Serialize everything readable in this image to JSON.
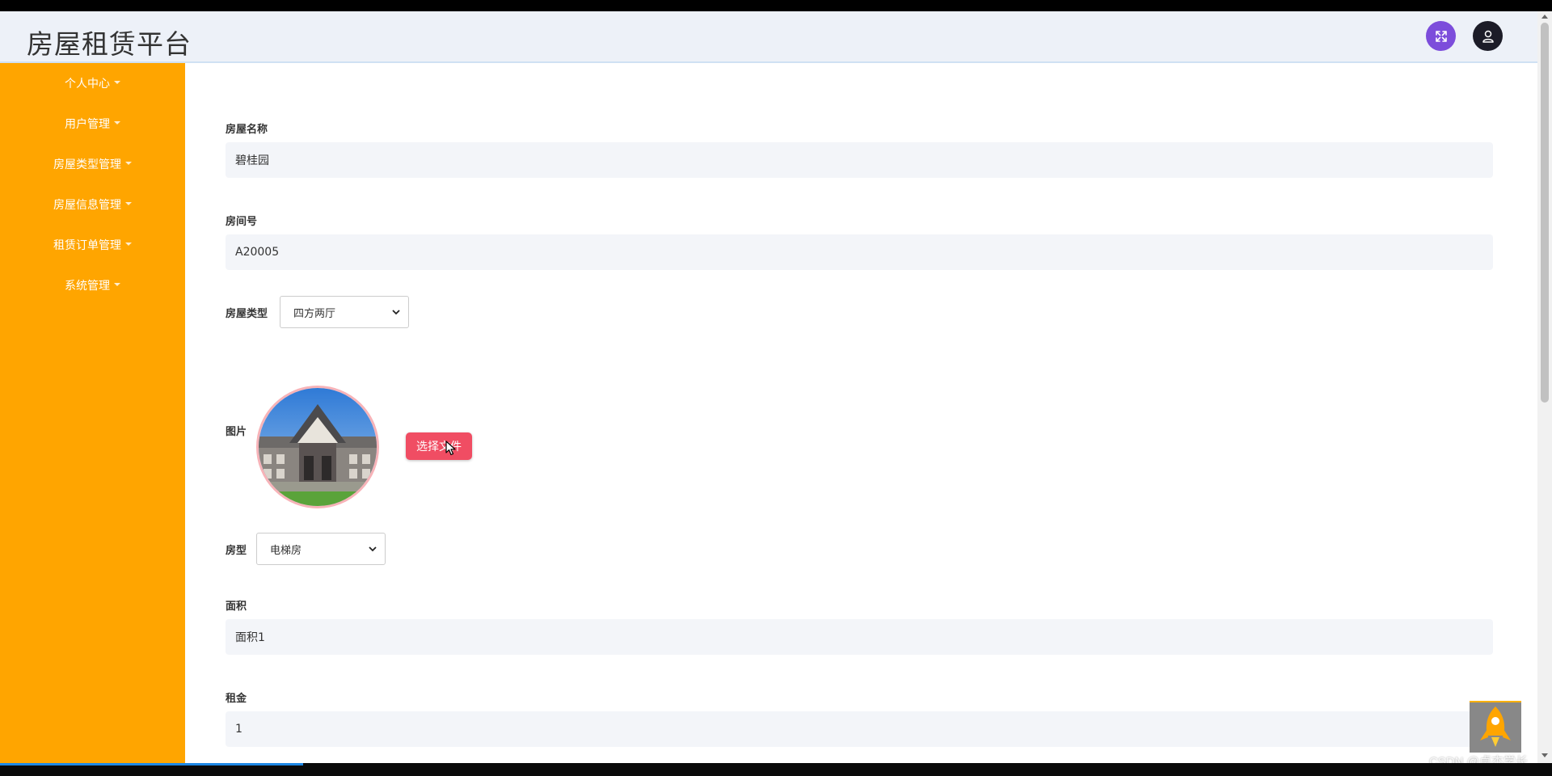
{
  "header": {
    "app_title": "房屋租赁平台"
  },
  "sidebar": {
    "items": [
      {
        "label": "个人中心"
      },
      {
        "label": "用户管理"
      },
      {
        "label": "房屋类型管理"
      },
      {
        "label": "房屋信息管理"
      },
      {
        "label": "租赁订单管理"
      },
      {
        "label": "系统管理"
      }
    ]
  },
  "form": {
    "house_name": {
      "label": "房屋名称",
      "value": "碧桂园"
    },
    "room_no": {
      "label": "房间号",
      "value": "A20005"
    },
    "house_type": {
      "label": "房屋类型",
      "selected": "四方两厅"
    },
    "picture": {
      "label": "图片",
      "button": "选择文件"
    },
    "layout": {
      "label": "房型",
      "selected": "电梯房"
    },
    "area": {
      "label": "面积",
      "value": "面积1"
    },
    "rent": {
      "label": "租金",
      "value": "1"
    }
  },
  "watermark": "CSDN @卓杰学长",
  "colors": {
    "sidebar": "#ffa500",
    "header": "#edf1f8",
    "file_button": "#f04d63",
    "fullscreen_button": "#7c4ddb",
    "user_button": "#1c1c28"
  },
  "icons": {
    "fullscreen": "expand-arrows-icon",
    "user": "user-icon",
    "back_to_top": "rocket-icon"
  }
}
